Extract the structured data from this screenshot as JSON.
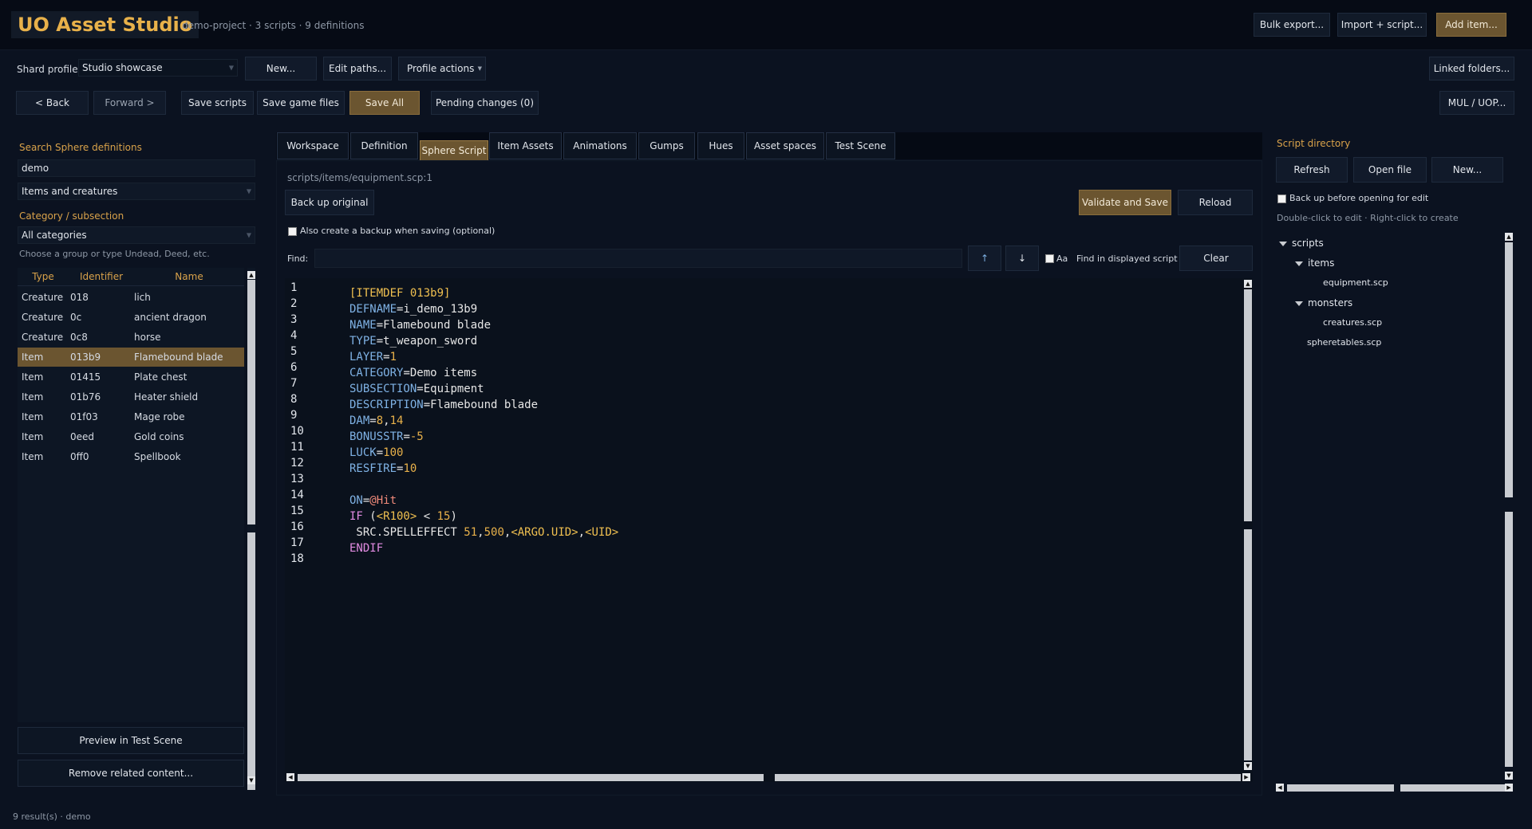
{
  "app": {
    "title": "UO Asset Studio",
    "project_info": "demo-project · 3 scripts · 9 definitions"
  },
  "header_actions": {
    "bulk_export": "Bulk export...",
    "import_script": "Import + script...",
    "add_item": "Add item..."
  },
  "profile_bar": {
    "label": "Shard profile",
    "profile_value": "Studio showcase",
    "new_label": "New...",
    "edit_paths_label": "Edit paths...",
    "profile_actions_label": "Profile actions",
    "linked_folders_label": "Linked folders..."
  },
  "toolbar": {
    "back_label": "< Back",
    "forward_label": "Forward >",
    "save_scripts_label": "Save scripts",
    "save_game_files_label": "Save game files",
    "save_all_label": "Save All",
    "pending_changes_label": "Pending changes (0)",
    "mul_uop_label": "MUL / UOP..."
  },
  "left_panel": {
    "search_heading": "Search Sphere definitions",
    "search_value": "demo",
    "filter_value": "Items and creatures",
    "category_heading": "Category / subsection",
    "category_value": "All categories",
    "category_hint": "Choose a group or type Undead, Deed, etc.",
    "columns": [
      "Type",
      "Identifier",
      "Name"
    ],
    "rows": [
      {
        "type": "Creature",
        "id": "018",
        "name": "lich"
      },
      {
        "type": "Creature",
        "id": "0c",
        "name": "ancient dragon"
      },
      {
        "type": "Creature",
        "id": "0c8",
        "name": "horse"
      },
      {
        "type": "Item",
        "id": "013b9",
        "name": "Flamebound blade"
      },
      {
        "type": "Item",
        "id": "01415",
        "name": "Plate chest"
      },
      {
        "type": "Item",
        "id": "01b76",
        "name": "Heater shield"
      },
      {
        "type": "Item",
        "id": "01f03",
        "name": "Mage robe"
      },
      {
        "type": "Item",
        "id": "0eed",
        "name": "Gold coins"
      },
      {
        "type": "Item",
        "id": "0ff0",
        "name": "Spellbook"
      }
    ],
    "selected_row": 3,
    "preview_label": "Preview in Test Scene",
    "remove_label": "Remove related content..."
  },
  "tabs": [
    "Workspace",
    "Definition",
    "Sphere Script",
    "Item Assets",
    "Animations",
    "Gumps",
    "Hues",
    "Asset spaces",
    "Test Scene"
  ],
  "active_tab": "Sphere Script",
  "editor": {
    "path": "scripts/items/equipment.scp:1",
    "backup_original_label": "Back up original",
    "validate_save_label": "Validate and Save",
    "reload_label": "Reload",
    "backup_option_label": "Also create a backup when saving (optional)",
    "find_label": "Find:",
    "find_value": "",
    "up_label": "↑",
    "down_label": "↓",
    "case_label": "Aa",
    "find_scope_label": "Find in displayed script",
    "clear_label": "Clear",
    "line_numbers": [
      "1",
      "2",
      "3",
      "4",
      "5",
      "6",
      "7",
      "8",
      "9",
      "10",
      "11",
      "12",
      "13",
      "14",
      "15",
      "16",
      "17",
      "18"
    ]
  },
  "right_panel": {
    "heading": "Script directory",
    "refresh_label": "Refresh",
    "open_file_label": "Open file",
    "new_label": "New...",
    "backup_option_label": "Back up before opening for edit",
    "hint": "Double-click to edit · Right-click to create",
    "tree": {
      "root": "scripts",
      "items_folder": "items",
      "equipment_file": "equipment.scp",
      "monsters_folder": "monsters",
      "creatures_file": "creatures.scp",
      "spheretables_file": "spheretables.scp"
    }
  },
  "status_bar": {
    "text": "9 result(s) · demo"
  },
  "colors": {
    "background": "#0b1220",
    "accent_gold": "#6b5530",
    "heading_gold": "#d9a24a",
    "logo_gold": "#e8b14a"
  }
}
